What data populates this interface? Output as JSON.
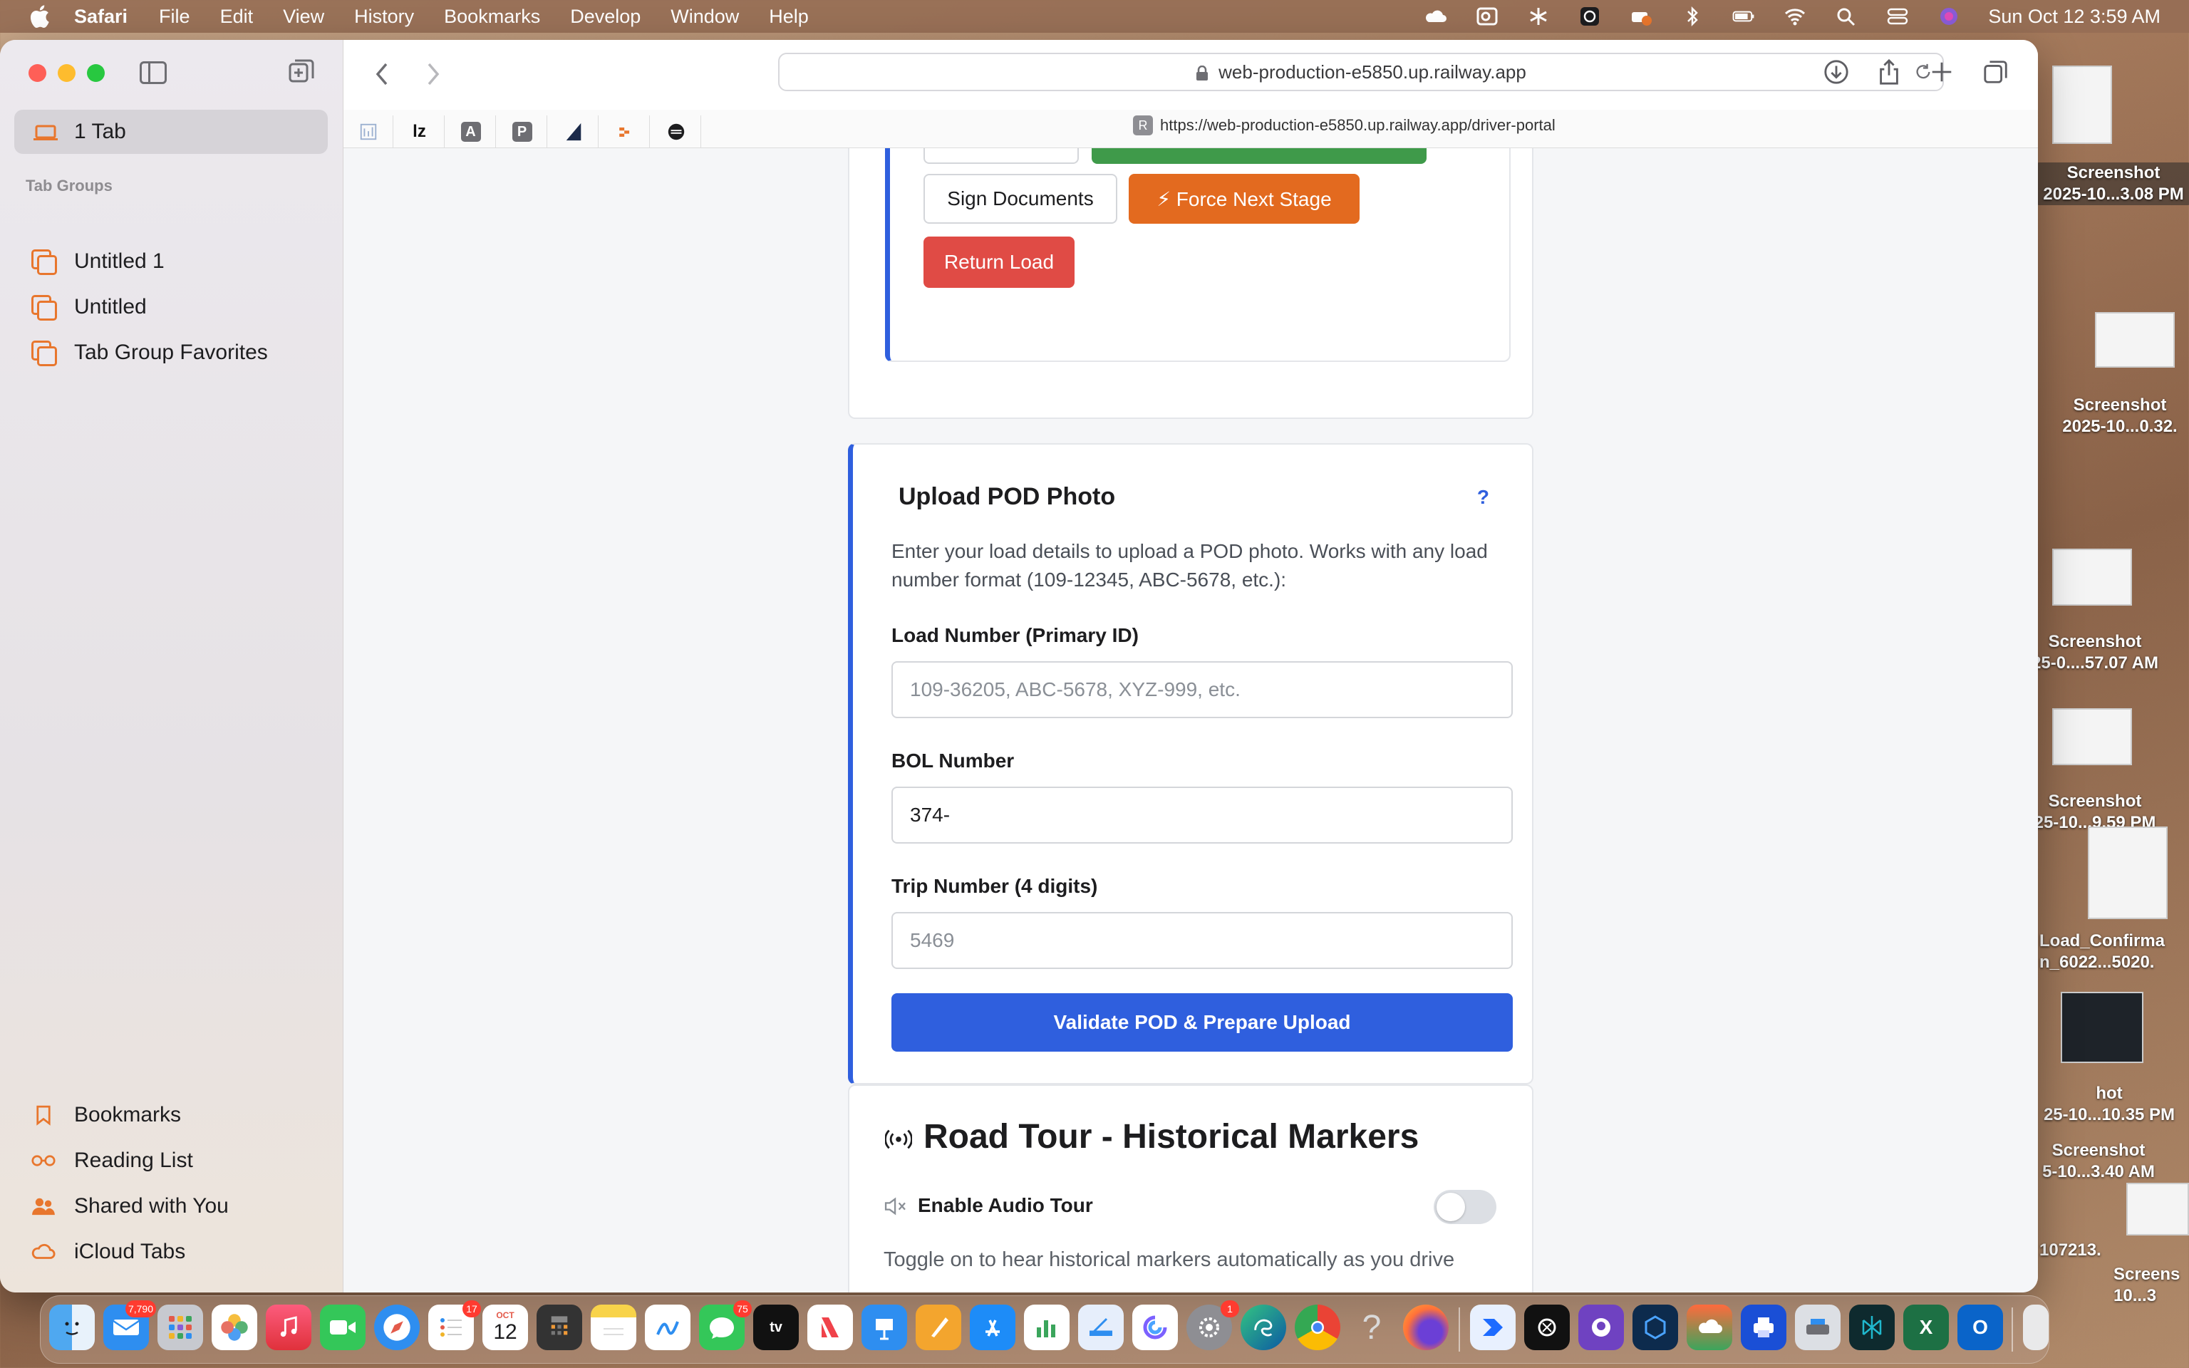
{
  "menubar": {
    "app_name": "Safari",
    "items": [
      "File",
      "Edit",
      "View",
      "History",
      "Bookmarks",
      "Develop",
      "Window",
      "Help"
    ],
    "clock": "Sun Oct 12  3:59 AM"
  },
  "sidebar": {
    "tab_label": "1 Tab",
    "tab_groups_heading": "Tab Groups",
    "groups": [
      "Untitled 1",
      "Untitled",
      "Tab Group Favorites"
    ],
    "bottom_items": [
      "Bookmarks",
      "Reading List",
      "Shared with You",
      "iCloud Tabs"
    ]
  },
  "toolbar": {
    "address": "web-production-e5850.up.railway.app",
    "hover_url": "https://web-production-e5850.up.railway.app/driver-portal"
  },
  "actions_card": {
    "sign_documents": "Sign Documents",
    "force_next_stage": "⚡ Force Next Stage",
    "return_load": "Return Load"
  },
  "upload_card": {
    "title": "Upload POD Photo",
    "help": "?",
    "description": "Enter your load details to upload a POD photo. Works with any load number format (109-12345, ABC-5678, etc.):",
    "load_label": "Load Number (Primary ID)",
    "load_placeholder": "109-36205, ABC-5678, XYZ-999, etc.",
    "bol_label": "BOL Number",
    "bol_value": "374-",
    "trip_label": "Trip Number (4 digits)",
    "trip_placeholder": "5469",
    "submit": "Validate POD & Prepare Upload"
  },
  "road_tour": {
    "title": "Road Tour - Historical Markers",
    "toggle_label": "Enable Audio Tour",
    "toggle_on": false,
    "description": "Toggle on to hear historical markers automatically as you drive"
  },
  "desktop": {
    "labels": [
      "Screenshot",
      "2025-10...3.08 PM",
      "Screenshot",
      "2025-10...0.32.",
      "Screenshot",
      "25-0....57.07 AM",
      "Screenshot",
      "25-10...9.59 PM",
      "Load_Confirma",
      "n_6022...5020.",
      "hot",
      "25-10...10.35 PM",
      "Screenshot",
      "5-10...3.40 AM",
      "107213.",
      "Screens",
      "10...3"
    ]
  },
  "dock": {
    "mail_badge": "7,790",
    "reminders_badge": "17",
    "calendar_month": "OCT",
    "calendar_day": "12",
    "messages_badge": "75",
    "settings_badge": "1"
  },
  "colors": {
    "primary_blue": "#2f5fde",
    "accent_orange": "#e36a1f",
    "danger_red": "#e04b45",
    "success_green": "#3f9a4a"
  }
}
